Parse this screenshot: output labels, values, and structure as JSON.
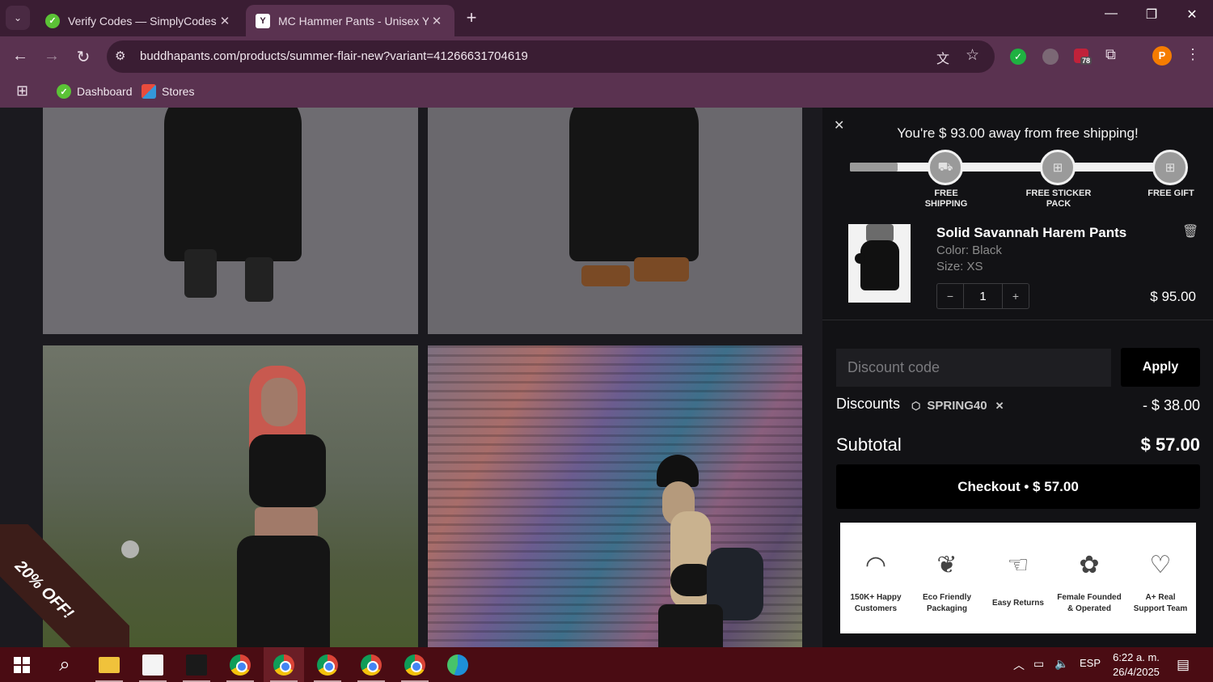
{
  "browser": {
    "tabs": [
      {
        "title": "Verify Codes — SimplyCodes",
        "active": false
      },
      {
        "title": "MC Hammer Pants - Unisex Yog",
        "active": true
      }
    ],
    "url": "buddhapants.com/products/summer-flair-new?variant=41266631704619",
    "extension_badge": "78",
    "profile_initial": "P",
    "bookmarks": [
      {
        "label": "Dashboard"
      },
      {
        "label": "Stores"
      }
    ]
  },
  "page": {
    "promo_ribbon": "20% OFF!"
  },
  "cart": {
    "shipping_message": "You're $ 93.00 away from free shipping!",
    "progress_fraction": 0.15,
    "milestones": [
      {
        "label": "FREE SHIPPING",
        "icon": "truck-icon"
      },
      {
        "label": "FREE STICKER PACK",
        "icon": "gift-icon"
      },
      {
        "label": "FREE GIFT",
        "icon": "gift-icon"
      }
    ],
    "item": {
      "name": "Solid Savannah Harem Pants",
      "color": "Color: Black",
      "size": "Size: XS",
      "quantity": "1",
      "price": "$ 95.00"
    },
    "discount_placeholder": "Discount code",
    "apply_label": "Apply",
    "discounts_label": "Discounts",
    "discount_code": "SPRING40",
    "discount_amount": "- $ 38.00",
    "subtotal_label": "Subtotal",
    "subtotal_value": "$ 57.00",
    "checkout_label": "Checkout • $ 57.00",
    "badges": [
      {
        "label": "150K+ Happy Customers",
        "icon": "rainbow-icon"
      },
      {
        "label": "Eco Friendly Packaging",
        "icon": "plant-icon"
      },
      {
        "label": "Easy Returns",
        "icon": "hand-icon"
      },
      {
        "label": "Female Founded & Operated",
        "icon": "flower-icon"
      },
      {
        "label": "A+ Real Support Team",
        "icon": "heart-icon"
      }
    ]
  },
  "taskbar": {
    "language": "ESP",
    "time": "6:22 a. m.",
    "date": "26/4/2025"
  }
}
